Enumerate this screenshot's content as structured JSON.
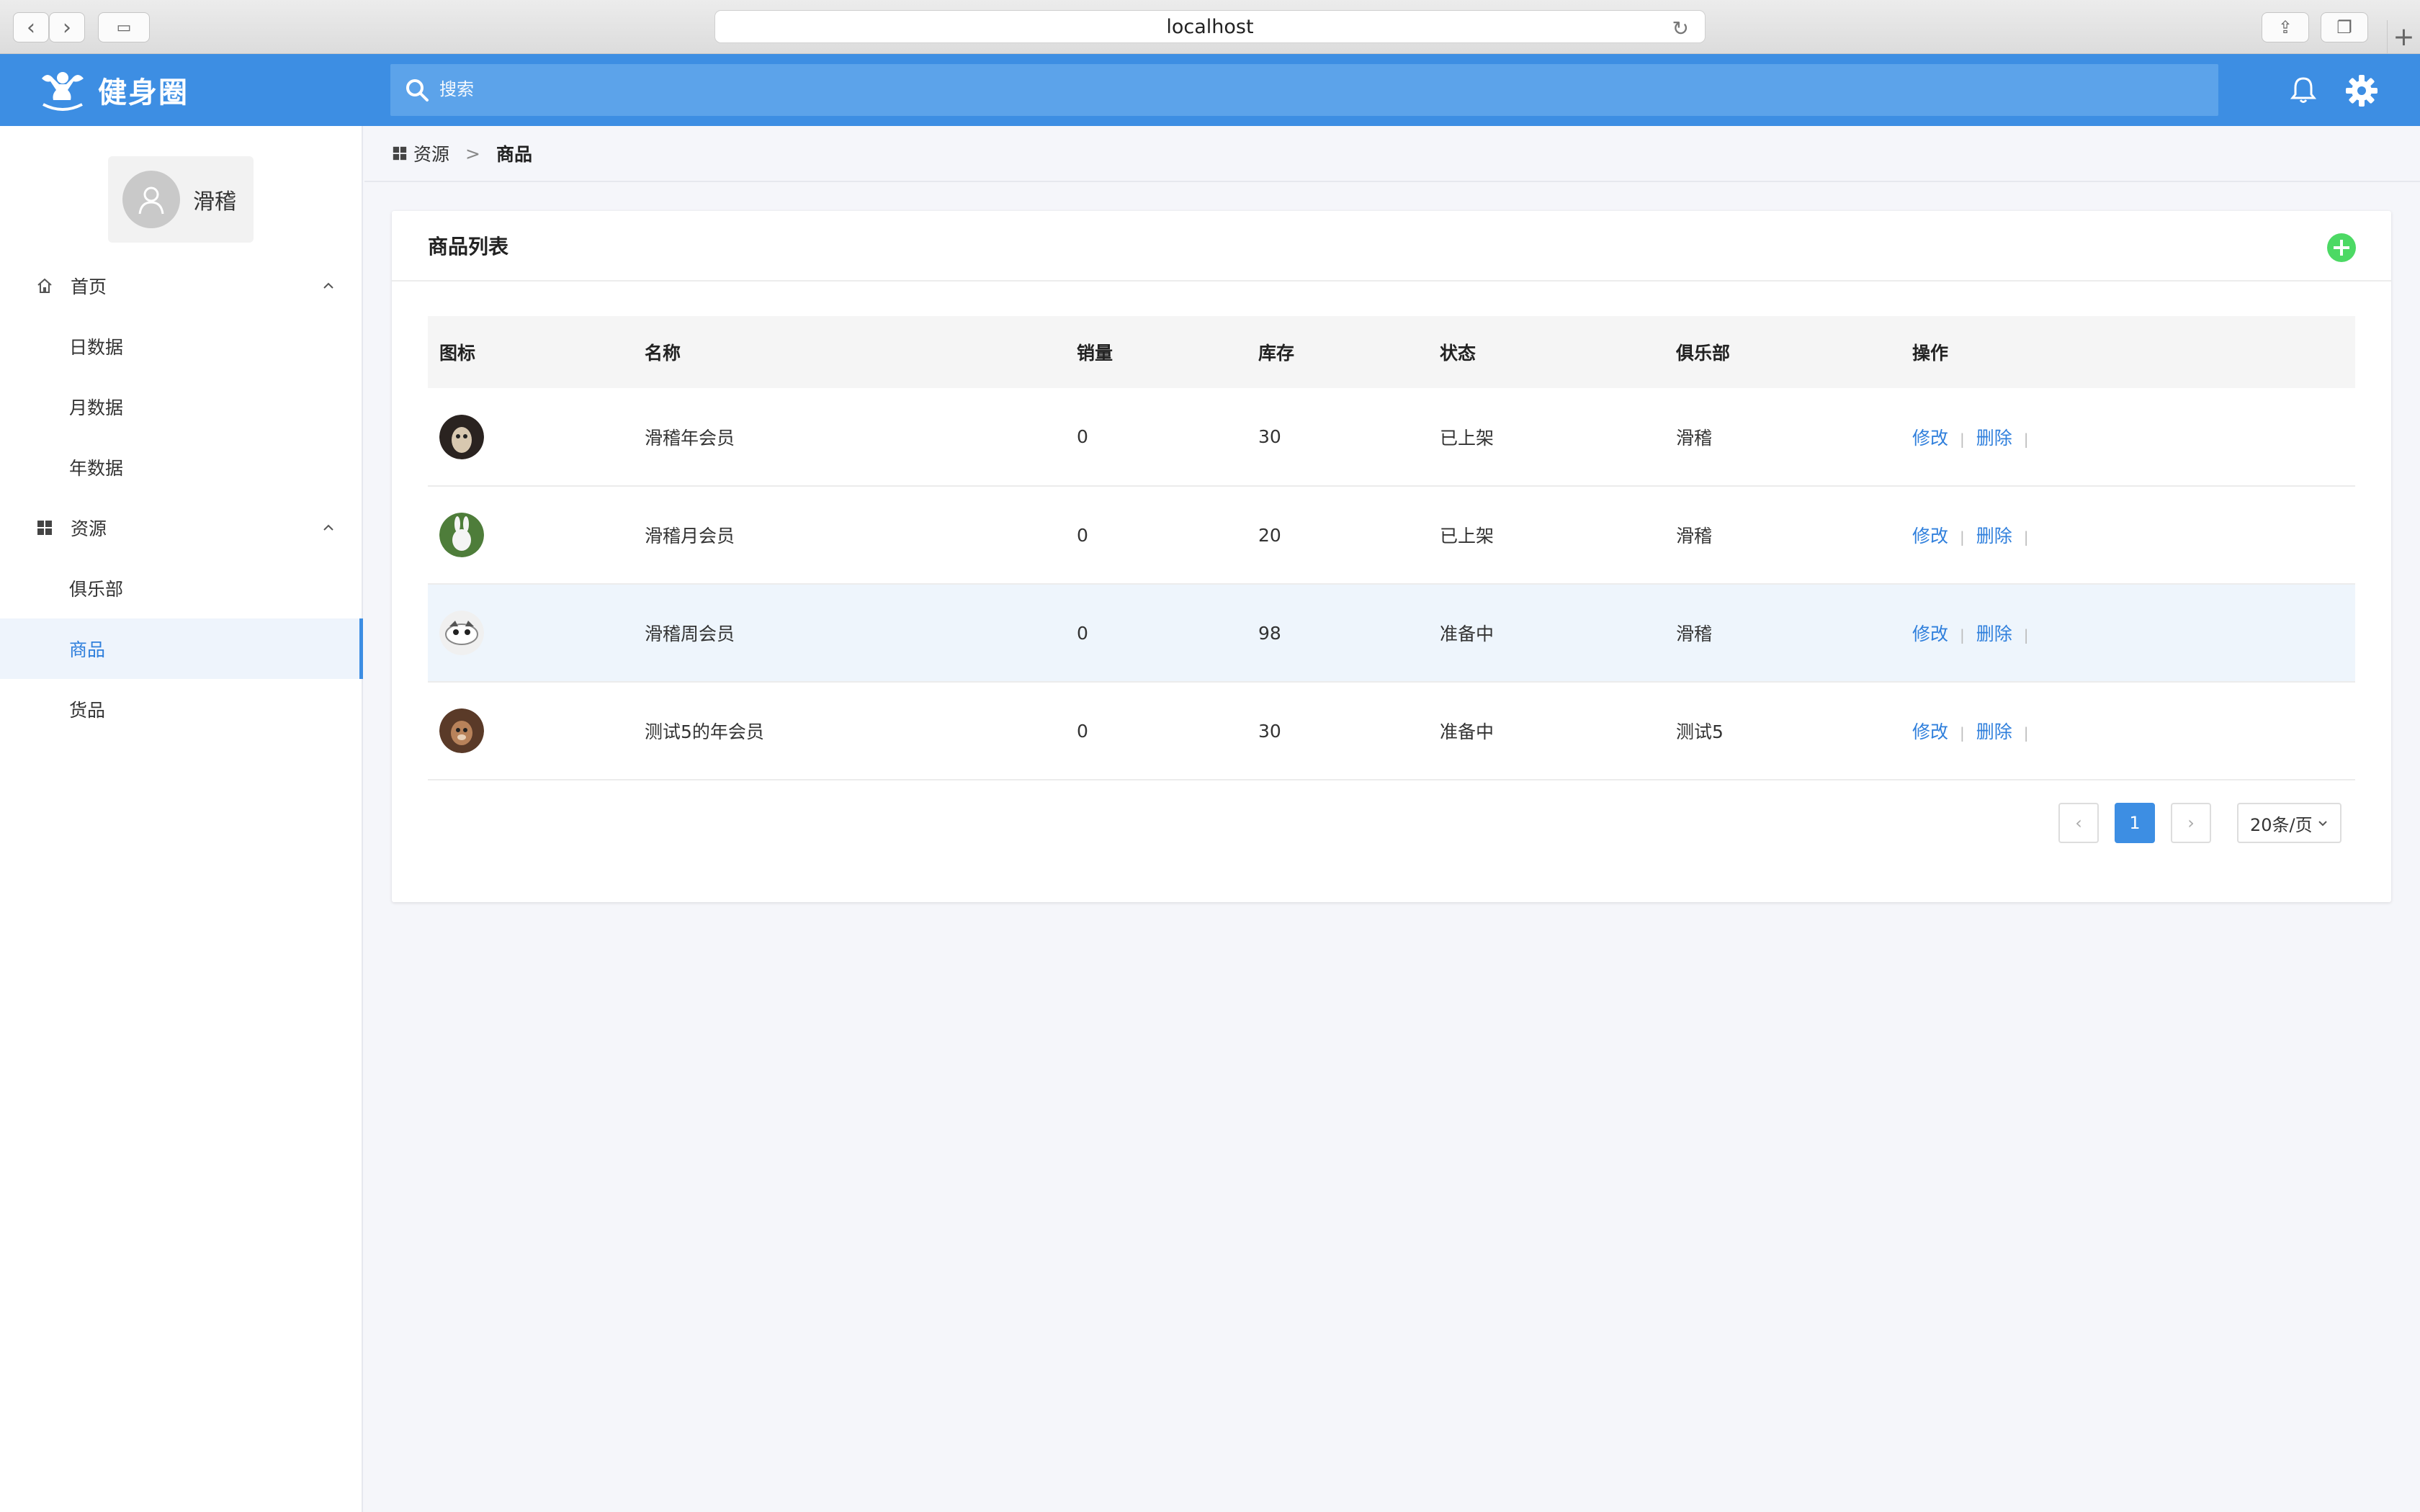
{
  "browser": {
    "url": "localhost"
  },
  "app": {
    "name": "健身圈",
    "search_placeholder": "搜索"
  },
  "user": {
    "name": "滑稽"
  },
  "sidebar": {
    "groups": [
      {
        "label": "首页",
        "icon": "home-icon",
        "items": [
          "日数据",
          "月数据",
          "年数据"
        ]
      },
      {
        "label": "资源",
        "icon": "grid-icon",
        "items": [
          "俱乐部",
          "商品",
          "货品"
        ]
      }
    ],
    "active": "商品"
  },
  "breadcrumb": {
    "parent": "资源",
    "separator": ">",
    "current": "商品"
  },
  "card": {
    "title": "商品列表"
  },
  "table": {
    "headers": [
      "图标",
      "名称",
      "销量",
      "库存",
      "状态",
      "俱乐部",
      "操作"
    ],
    "rows": [
      {
        "name": "滑稽年会员",
        "sales": "0",
        "stock": "30",
        "status": "已上架",
        "club": "滑稽"
      },
      {
        "name": "滑稽月会员",
        "sales": "0",
        "stock": "20",
        "status": "已上架",
        "club": "滑稽"
      },
      {
        "name": "滑稽周会员",
        "sales": "0",
        "stock": "98",
        "status": "准备中",
        "club": "滑稽"
      },
      {
        "name": "测试5的年会员",
        "sales": "0",
        "stock": "30",
        "status": "准备中",
        "club": "测试5"
      }
    ],
    "actions": {
      "edit": "修改",
      "delete": "删除",
      "separator": "|"
    }
  },
  "pagination": {
    "prev": "‹",
    "current": "1",
    "next": "›",
    "page_size": "20条/页"
  },
  "colors": {
    "primary": "#3d8ee3",
    "add": "#4cd964"
  }
}
